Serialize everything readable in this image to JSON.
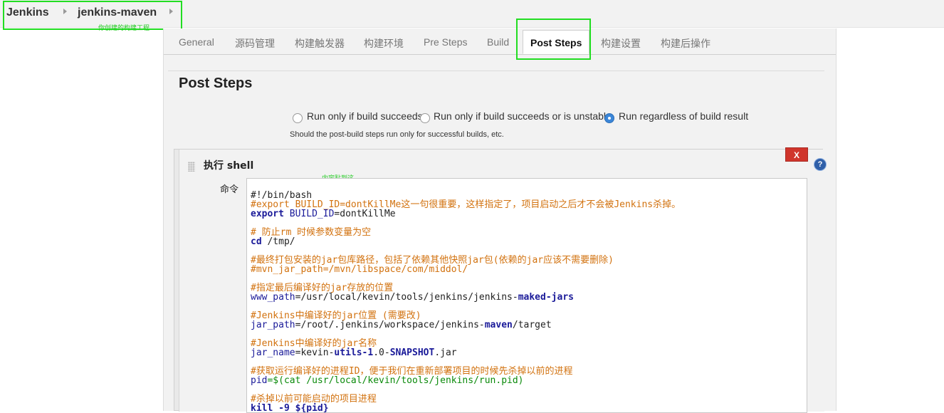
{
  "breadcrumb": {
    "root": "Jenkins",
    "job": "jenkins-maven",
    "note": "你创建的构建工程"
  },
  "tabs": [
    "General",
    "源码管理",
    "构建触发器",
    "构建环境",
    "Pre Steps",
    "Build",
    "Post Steps",
    "构建设置",
    "构建后操作"
  ],
  "active_tab": "Post Steps",
  "section": {
    "title": "Post Steps",
    "options": [
      "Run only if build succeeds",
      "Run only if build succeeds or is unstable",
      "Run regardless of build result"
    ],
    "selected": "Run regardless of build result",
    "help": "Should the post-build steps run only for successful builds, etc."
  },
  "shell": {
    "title": "执行 shell",
    "delete_label": "X",
    "help_label": "?",
    "command_label": "命令",
    "note": "内容贴到这",
    "lines": {
      "l1": "#!/bin/bash",
      "l2": "#export BUILD_ID=dontKillMe这一句很重要，这样指定了，项目启动之后才不会被Jenkins杀掉。",
      "l3_kw": "export",
      "l3_var": "BUILD_ID",
      "l3_rest": "=dontKillMe",
      "l4": "# 防止rm 时候参数变量为空",
      "l5_kw": "cd",
      "l5_rest": " /tmp/",
      "l6": "#最终打包安装的jar包库路径，包括了依赖其他快照jar包(依赖的jar应该不需要删除)",
      "l7": "#mvn_jar_path=/mvn/libspace/com/middol/",
      "l8": "#指定最后编译好的jar存放的位置",
      "l9_var": "www_path",
      "l9_rest": "=/usr/local/kevin/tools/jenkins/jenkins-",
      "l9_tail": "maked-jars",
      "l10": "#Jenkins中编译好的jar位置 (需要改)",
      "l11_var": "jar_path",
      "l11_rest": "=/root/.jenkins/workspace/jenkins-",
      "l11_kw": "maven",
      "l11_tail": "/target",
      "l12": "#Jenkins中编译好的jar名称",
      "l13_var": "jar_name",
      "l13_rest": "=kevin-",
      "l13_kw": "utils-1",
      "l13_mid": ".0-",
      "l13_kw2": "SNAPSHOT",
      "l13_tail": ".jar",
      "l14": "#获取运行编译好的进程ID，便于我们在重新部署项目的时候先杀掉以前的进程",
      "l15_var": "pid",
      "l15_rest": "=$(cat /usr/local/kevin/tools/jenkins/run.pid)",
      "l16": "#杀掉以前可能启动的项目进程",
      "l17_kw": "kill -9",
      "l17_rest": " ${pid}"
    }
  },
  "colors": {
    "highlight": "#22dd22",
    "comment": "#d2720f",
    "keyword": "#1a1a99",
    "delete": "#d0352c"
  }
}
